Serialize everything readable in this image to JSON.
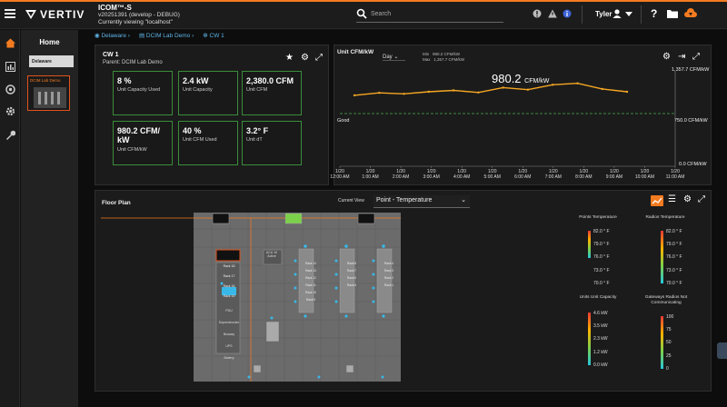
{
  "app": {
    "logo_text": "VERTIV",
    "name": "ICOM™-S",
    "version": "v20251391 (develop - DEBUG)",
    "viewing": "Currently viewing \"localhost\"",
    "search_placeholder": "Search",
    "user": "Tyler",
    "accent": "#f47b20"
  },
  "nav": {
    "title": "Home",
    "site": "Delaware",
    "thumb_label": "DCIM Lab Demo"
  },
  "breadcrumbs": [
    "Delaware",
    "DCIM Lab Demo",
    "CW 1"
  ],
  "unit": {
    "title": "CW 1",
    "parent": "Parent: DCIM Lab Demo",
    "metrics": [
      {
        "value": "8 %",
        "label": "Unit Capacity Used"
      },
      {
        "value": "2.4 kW",
        "label": "Unit Capacity"
      },
      {
        "value": "2,380.0 CFM",
        "label": "Unit CFM"
      },
      {
        "value": "980.2 CFM/ kW",
        "label": "Unit CFM/kW"
      },
      {
        "value": "40 %",
        "label": "Unit CFM Used"
      },
      {
        "value": "3.2° F",
        "label": "Unit dT"
      }
    ]
  },
  "chart_panel": {
    "title": "Unit CFM/kW",
    "range": "Day",
    "min_label": "Min",
    "min_value": "980.2 CFM/kW",
    "max_label": "Max",
    "max_value": "1,357.7 CFM/kW",
    "current_value": "980.2",
    "current_unit": "CFM/kW",
    "good_label": "Good"
  },
  "chart_data": {
    "type": "line",
    "title": "Unit CFM/kW",
    "y_tick_labels": [
      "1,357.7 CFM/kW",
      "750.0 CFM/kW",
      "0.0 CFM/kW"
    ],
    "threshold": 750.0,
    "ylim": [
      0,
      1357.7
    ],
    "x": [
      "1/20 12:00 AM",
      "1/20 1:00 AM",
      "1/20 2:00 AM",
      "1/20 3:00 AM",
      "1/20 4:00 AM",
      "1/20 5:00 AM",
      "1/20 6:00 AM",
      "1/20 7:00 AM",
      "1/20 8:00 AM",
      "1/20 9:00 AM",
      "1/20 10:00 AM",
      "1/20 11:00 AM"
    ],
    "series": [
      {
        "values": [
          1010,
          1045,
          1030,
          1060,
          1080,
          1050,
          1120,
          1090,
          1160,
          1180,
          1100,
          1060
        ]
      }
    ],
    "color": "#f5a623",
    "threshold_color": "#4caf50"
  },
  "floor": {
    "title": "Floor Plan",
    "current_view_label": "Current View",
    "current_view": "Point - Temperature",
    "legends": [
      {
        "title": "Points Temperature",
        "ticks": [
          "82.0 ° F",
          "79.0 ° F",
          "76.0 ° F",
          "73.0 ° F",
          "70.0 ° F"
        ]
      },
      {
        "title": "Radios Temperature",
        "ticks": [
          "82.0 ° F",
          "79.0 ° F",
          "76.0 ° F",
          "73.0 ° F",
          "70.0 ° F"
        ]
      },
      {
        "title": "Units Unit Capacity",
        "ticks": [
          "4.6 kW",
          "3.5 kW",
          "2.3 kW",
          "1.2 kW",
          "0.0 kW"
        ]
      },
      {
        "title": "Gateways Radios Not Communicating",
        "ticks": [
          "100",
          "75",
          "50",
          "25",
          "0"
        ]
      }
    ],
    "rack_labels": [
      "Rack 18",
      "Rack 17",
      "Rack 16",
      "Rack 15",
      "Rack 14",
      "Rack 13",
      "Rack 12",
      "Rack 11",
      "Rack 10",
      "Rack 9",
      "Rack 8",
      "Rack 7",
      "Rack 6",
      "Rack 5",
      "Rack 4",
      "Rack 3",
      "Rack 2",
      "Rack 1"
    ],
    "misc_labels": [
      "PDU Dependencies",
      "Busway",
      "UPS",
      "Battery",
      "ACU 10 Active"
    ]
  }
}
